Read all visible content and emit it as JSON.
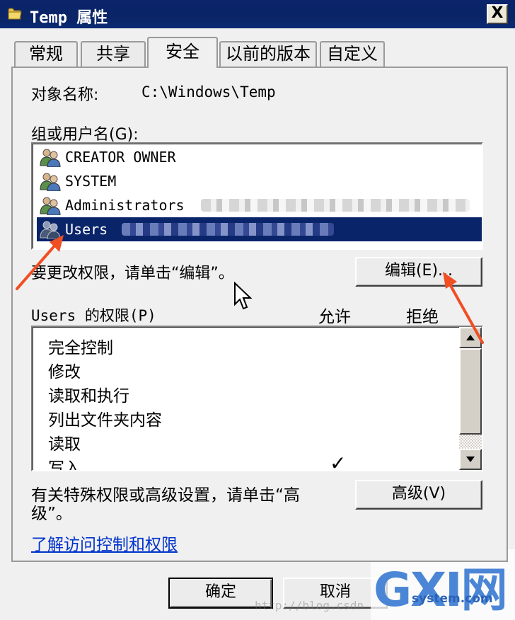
{
  "window": {
    "title": "Temp 属性",
    "close_label": "X"
  },
  "tabs": [
    {
      "label": "常规"
    },
    {
      "label": "共享"
    },
    {
      "label": "安全"
    },
    {
      "label": "以前的版本"
    },
    {
      "label": "自定义"
    }
  ],
  "security": {
    "object_name_label": "对象名称:",
    "object_name_value": "C:\\Windows\\Temp",
    "groups_label": "组或用户名(G):",
    "users": [
      {
        "name": "CREATOR OWNER",
        "icon": "user-group-icon"
      },
      {
        "name": "SYSTEM",
        "icon": "user-group-icon"
      },
      {
        "name": "Administrators",
        "icon": "user-group-icon"
      },
      {
        "name": "Users",
        "icon": "user-group-icon",
        "selected": true
      }
    ],
    "edit_hint": "要更改权限，请单击“编辑”。",
    "edit_button": "编辑(E)...",
    "permissions_label": "Users 的权限(P)",
    "allow_header": "允许",
    "deny_header": "拒绝",
    "permissions": [
      {
        "name": "完全控制",
        "allow": false
      },
      {
        "name": "修改",
        "allow": false
      },
      {
        "name": "读取和执行",
        "allow": false
      },
      {
        "name": "列出文件夹内容",
        "allow": false
      },
      {
        "name": "读取",
        "allow": false
      },
      {
        "name": "写入",
        "allow": true
      }
    ],
    "check_mark": "✓",
    "advanced_hint_line1": "有关特殊权限或高级设置，请单击“高",
    "advanced_hint_line2": "级”。",
    "advanced_button": "高级(V)",
    "learn_link": "了解访问控制和权限"
  },
  "footer": {
    "ok_button": "确定",
    "cancel_button": "取消"
  },
  "watermark": {
    "logo_text": "GXI网",
    "site_text": "system.com",
    "url_text": "http://blog.csdn"
  },
  "colors": {
    "titlebar": "#0a246a",
    "selection": "#0a246a",
    "link": "#0033cc",
    "annotation_arrow": "#f04e23"
  }
}
